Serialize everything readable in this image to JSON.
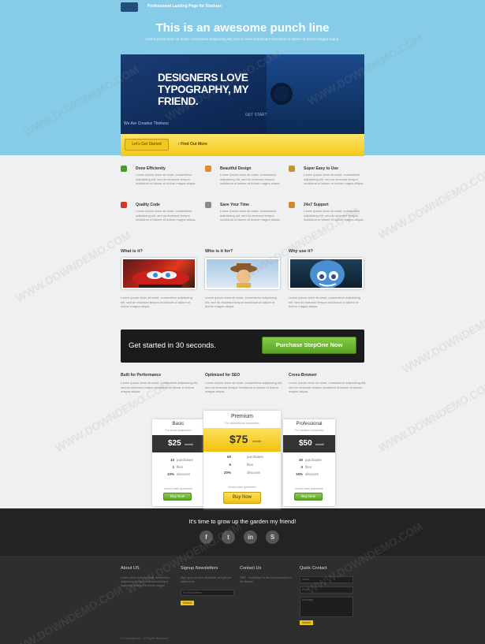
{
  "header": {
    "tagline": "Professional Landing Page for Startups",
    "punch_line": "This is an awesome punch line",
    "punch_sub": "Lorem ipsum dolor sit amet, consectetur adipisicing elit, sed do eiusmod tempor incididunt ut labore et dolore magna aliqua."
  },
  "banner": {
    "headline_1": "DESIGNERS LOVE",
    "headline_2": "TYPOGRAPHY, MY",
    "headline_3": "FRIEND.",
    "caption": "We Are Creative Thinkers",
    "caption_right": "GET START",
    "start_label": "Let's Get Started",
    "find_out_label": "Find Out More"
  },
  "features": [
    {
      "title": "Done Efficiently",
      "icon": "checkmark-icon",
      "color": "#4a9b2e",
      "text": "Lorem ipsum dolor sit amet, consectetur adipisicing elit, sed do eiusmod tempor incididunt ut labore et dolore magna aliqua."
    },
    {
      "title": "Beautiful Design",
      "icon": "chart-icon",
      "color": "#e08a2a",
      "text": "Lorem ipsum dolor sit amet, consectetur adipisicing elit, sed do eiusmod tempor incididunt ut labore et dolore magna aliqua."
    },
    {
      "title": "Super Easy to Use",
      "icon": "box-icon",
      "color": "#c8902f",
      "text": "Lorem ipsum dolor sit amet, consectetur adipisicing elit, sed do eiusmod tempor incididunt ut labore et dolore magna aliqua."
    },
    {
      "title": "Quality Code",
      "icon": "heart-icon",
      "color": "#d03a2c",
      "text": "Lorem ipsum dolor sit amet, consectetur adipisicing elit, sed do eiusmod tempor incididunt ut labore et dolore magna aliqua."
    },
    {
      "title": "Save Your Time",
      "icon": "clock-icon",
      "color": "#8a8a8a",
      "text": "Lorem ipsum dolor sit amet, consectetur adipisicing elit, sed do eiusmod tempor incididunt ut labore et dolore magna aliqua."
    },
    {
      "title": "24x7 Support",
      "icon": "support-icon",
      "color": "#d8862a",
      "text": "Lorem ipsum dolor sit amet, consectetur adipisicing elit, sed do eiusmod tempor incididunt ut labore et dolore magna aliqua."
    }
  ],
  "columns": [
    {
      "heading": "What is it?",
      "text": "Lorem ipsum dolor sit amet, consectetur adipisicing elit, sed do eiusmod tempor incididunt ut labore et dolore magna aliqua."
    },
    {
      "heading": "Who is it for?",
      "text": "Lorem ipsum dolor sit amet, consectetur adipisicing elit, sed do eiusmod tempor incididunt ut labore et dolore magna aliqua."
    },
    {
      "heading": "Why use it?",
      "text": "Lorem ipsum dolor sit amet, consectetur adipisicing elit, sed do eiusmod tempor incididunt ut labore et dolore magna aliqua."
    }
  ],
  "cta": {
    "text": "Get started in 30 seconds.",
    "button": "Purchase StepOne Now"
  },
  "perf": [
    {
      "heading": "Built for Performance",
      "text": "Lorem ipsum dolor sit amet, consectetur adipisicing elit, sed do eiusmod tempor incididunt ut labore et dolore magna aliqua."
    },
    {
      "heading": "Optimized for SEO",
      "text": "Lorem ipsum dolor sit amet, consectetur adipisicing elit, sed do eiusmod tempor incididunt ut labore et dolore magna aliqua."
    },
    {
      "heading": "Cross-Browser",
      "text": "Lorem ipsum dolor sit amet, consectetur adipisicing elit, sed do eiusmod tempor incididunt ut labore et dolore magna aliqua."
    }
  ],
  "pricing": {
    "basic": {
      "name": "Basic",
      "sub": "For small businesses",
      "price": "$25",
      "per": "/month",
      "lines": [
        [
          "10",
          "purchases"
        ],
        [
          "1",
          "files"
        ],
        [
          "10%",
          "discount"
        ]
      ],
      "guarantee": "money back guarantee",
      "button": "Buy Now"
    },
    "premium": {
      "name": "Premium",
      "sub": "For international companies",
      "price": "$75",
      "per": "/month",
      "lines": [
        [
          "50",
          "purchases"
        ],
        [
          "5",
          "files"
        ],
        [
          "20%",
          "discount"
        ]
      ],
      "guarantee": "money back guarantee",
      "button": "Buy Now"
    },
    "professional": {
      "name": "Professional",
      "sub": "For medium companies",
      "price": "$50",
      "per": "/month",
      "lines": [
        [
          "30",
          "purchases"
        ],
        [
          "3",
          "files"
        ],
        [
          "15%",
          "discount"
        ]
      ],
      "guarantee": "money back guarantee",
      "button": "Buy Now"
    }
  },
  "footer": {
    "grow": "It's time to grow up the garden my friend!",
    "social": [
      {
        "icon": "facebook-icon",
        "glyph": "f"
      },
      {
        "icon": "twitter-icon",
        "glyph": "t"
      },
      {
        "icon": "linkedin-icon",
        "glyph": "in"
      },
      {
        "icon": "skype-icon",
        "glyph": "S"
      }
    ],
    "about_h": "About US",
    "about_t": "Lorem ipsum dolor sit amet, consectetur adipisicing elit, sed do eiusmod tempor incididunt ut labore et dolore magna.",
    "news_h": "Signup Newsletters",
    "news_t": "Sign up to our free newsletter and get our latest news.",
    "news_placeholder": "E-mail address",
    "news_button": "Submit",
    "contact_h": "Contact Us",
    "contact_t": "1587 - Inneb0ing On the real connection in the Bhutan",
    "quick_h": "Quick Contact",
    "quick_name": "Name",
    "quick_email": "Email",
    "quick_message": "Message",
    "quick_button": "Submit",
    "copyright": "© Copyright Link - All Rights Reserved"
  },
  "watermark": "WWW.DOWNDEMO.COM"
}
